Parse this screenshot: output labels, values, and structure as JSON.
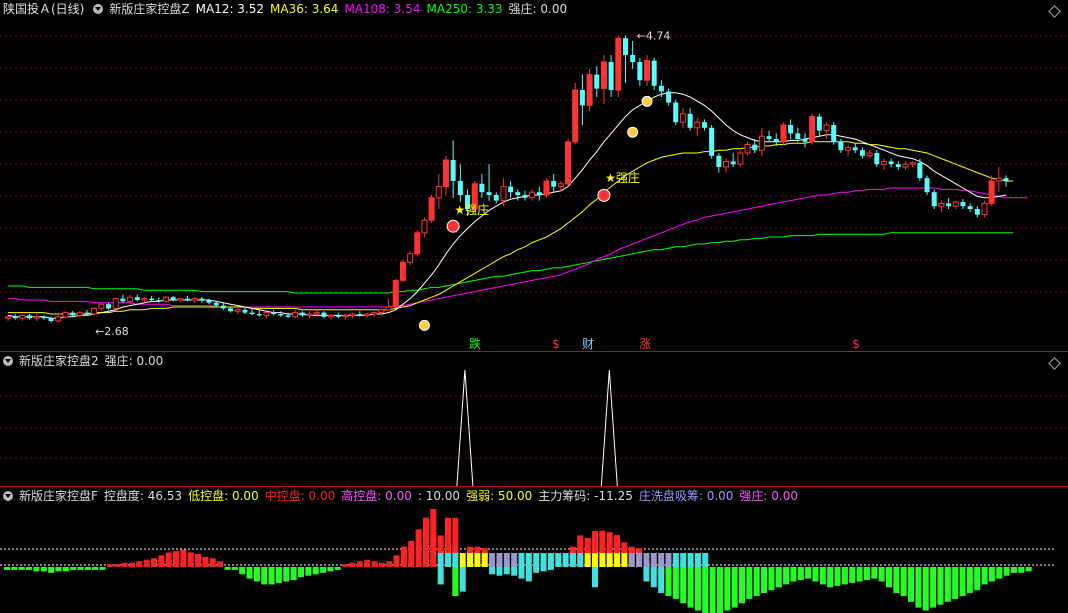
{
  "main": {
    "title": "陕国投Ａ(日线)",
    "indicator": "新版庄家控盘Z",
    "ma12": "MA12: 3.52",
    "ma36": "MA36: 3.64",
    "ma108": "MA108: 3.54",
    "ma250": "MA250: 3.33",
    "qz": "强庄: 0.00",
    "high_label": "4.74",
    "low_label": "2.68",
    "qz_tags": [
      "强庄",
      "强庄"
    ],
    "signals": [
      "跌",
      "$",
      "财",
      "涨",
      "$"
    ]
  },
  "panel2": {
    "indicator": "新版庄家控盘2",
    "qz": "强庄: 0.00"
  },
  "panel3": {
    "indicator": "新版庄家控盘F",
    "kongpandu": "控盘度: 46.53",
    "low": "低控盘: 0.00",
    "mid": "中控盘: 0.00",
    "high": "高控盘: 0.00",
    "ten": ": 10.00",
    "strength": "强弱: 50.00",
    "main_chip": "主力筹码: -11.25",
    "wash": "庄洗盘吸筹: 0.00",
    "qz": "强庄: 0.00"
  },
  "colors": {
    "up": "#ff3333",
    "down": "#54ffff",
    "ma12": "#ffffff",
    "ma36": "#ffff00",
    "ma108": "#ff00ff",
    "ma250": "#00ff00",
    "low": "#ffff00",
    "mid": "#ff2222",
    "high": "#ff55ff",
    "strength": "#ffff00",
    "wash": "#9999ff",
    "qz": "#ff55ff"
  },
  "chart_data": {
    "type": "candlestick",
    "ylim": [
      2.6,
      4.85
    ],
    "candles": [
      [
        2.72,
        2.74,
        2.7,
        2.73
      ],
      [
        2.73,
        2.75,
        2.71,
        2.72
      ],
      [
        2.72,
        2.74,
        2.7,
        2.74
      ],
      [
        2.74,
        2.75,
        2.71,
        2.72
      ],
      [
        2.72,
        2.75,
        2.7,
        2.73
      ],
      [
        2.73,
        2.74,
        2.71,
        2.72
      ],
      [
        2.72,
        2.73,
        2.69,
        2.7
      ],
      [
        2.7,
        2.74,
        2.69,
        2.73
      ],
      [
        2.73,
        2.77,
        2.72,
        2.76
      ],
      [
        2.76,
        2.77,
        2.73,
        2.74
      ],
      [
        2.74,
        2.77,
        2.73,
        2.76
      ],
      [
        2.76,
        2.78,
        2.74,
        2.75
      ],
      [
        2.75,
        2.8,
        2.74,
        2.79
      ],
      [
        2.79,
        2.83,
        2.77,
        2.82
      ],
      [
        2.82,
        2.83,
        2.78,
        2.79
      ],
      [
        2.79,
        2.87,
        2.78,
        2.86
      ],
      [
        2.86,
        2.89,
        2.83,
        2.84
      ],
      [
        2.84,
        2.89,
        2.82,
        2.87
      ],
      [
        2.87,
        2.89,
        2.84,
        2.85
      ],
      [
        2.85,
        2.87,
        2.83,
        2.86
      ],
      [
        2.86,
        2.88,
        2.84,
        2.85
      ],
      [
        2.85,
        2.87,
        2.83,
        2.84
      ],
      [
        2.84,
        2.88,
        2.83,
        2.87
      ],
      [
        2.87,
        2.88,
        2.84,
        2.85
      ],
      [
        2.85,
        2.86,
        2.83,
        2.86
      ],
      [
        2.86,
        2.88,
        2.84,
        2.85
      ],
      [
        2.85,
        2.87,
        2.83,
        2.86
      ],
      [
        2.86,
        2.87,
        2.83,
        2.85
      ],
      [
        2.85,
        2.86,
        2.82,
        2.83
      ],
      [
        2.83,
        2.84,
        2.8,
        2.81
      ],
      [
        2.81,
        2.83,
        2.78,
        2.79
      ],
      [
        2.79,
        2.8,
        2.76,
        2.77
      ],
      [
        2.77,
        2.79,
        2.75,
        2.78
      ],
      [
        2.78,
        2.8,
        2.75,
        2.76
      ],
      [
        2.76,
        2.79,
        2.74,
        2.75
      ],
      [
        2.75,
        2.78,
        2.73,
        2.74
      ],
      [
        2.74,
        2.76,
        2.72,
        2.76
      ],
      [
        2.76,
        2.78,
        2.74,
        2.75
      ],
      [
        2.75,
        2.77,
        2.73,
        2.74
      ],
      [
        2.74,
        2.76,
        2.72,
        2.73
      ],
      [
        2.73,
        2.78,
        2.72,
        2.76
      ],
      [
        2.76,
        2.77,
        2.73,
        2.74
      ],
      [
        2.74,
        2.77,
        2.72,
        2.75
      ],
      [
        2.75,
        2.78,
        2.73,
        2.76
      ],
      [
        2.76,
        2.77,
        2.72,
        2.73
      ],
      [
        2.73,
        2.75,
        2.71,
        2.74
      ],
      [
        2.74,
        2.76,
        2.72,
        2.73
      ],
      [
        2.73,
        2.75,
        2.71,
        2.74
      ],
      [
        2.74,
        2.76,
        2.72,
        2.75
      ],
      [
        2.75,
        2.77,
        2.73,
        2.74
      ],
      [
        2.74,
        2.76,
        2.72,
        2.75
      ],
      [
        2.75,
        2.77,
        2.73,
        2.76
      ],
      [
        2.76,
        2.79,
        2.74,
        2.78
      ],
      [
        2.78,
        2.86,
        2.77,
        2.8
      ],
      [
        2.8,
        3.0,
        2.8,
        2.99
      ],
      [
        2.99,
        3.14,
        2.98,
        3.12
      ],
      [
        3.12,
        3.2,
        3.1,
        3.18
      ],
      [
        3.18,
        3.35,
        3.16,
        3.33
      ],
      [
        3.33,
        3.44,
        3.3,
        3.42
      ],
      [
        3.42,
        3.6,
        3.4,
        3.58
      ],
      [
        3.58,
        3.75,
        3.5,
        3.66
      ],
      [
        3.66,
        3.88,
        3.6,
        3.85
      ],
      [
        3.85,
        3.99,
        3.58,
        3.7
      ],
      [
        3.7,
        3.82,
        3.55,
        3.6
      ],
      [
        3.6,
        3.64,
        3.45,
        3.5
      ],
      [
        3.5,
        3.7,
        3.48,
        3.68
      ],
      [
        3.68,
        3.75,
        3.58,
        3.62
      ],
      [
        3.62,
        3.82,
        3.56,
        3.6
      ],
      [
        3.6,
        3.62,
        3.54,
        3.56
      ],
      [
        3.56,
        3.72,
        3.52,
        3.66
      ],
      [
        3.66,
        3.7,
        3.58,
        3.62
      ],
      [
        3.62,
        3.64,
        3.56,
        3.6
      ],
      [
        3.6,
        3.63,
        3.56,
        3.58
      ],
      [
        3.58,
        3.64,
        3.56,
        3.62
      ],
      [
        3.62,
        3.66,
        3.56,
        3.6
      ],
      [
        3.6,
        3.72,
        3.58,
        3.7
      ],
      [
        3.7,
        3.75,
        3.62,
        3.66
      ],
      [
        3.66,
        3.7,
        3.62,
        3.68
      ],
      [
        3.68,
        4.0,
        3.66,
        3.98
      ],
      [
        3.98,
        4.4,
        3.96,
        4.35
      ],
      [
        4.35,
        4.46,
        4.1,
        4.24
      ],
      [
        4.24,
        4.5,
        4.2,
        4.46
      ],
      [
        4.46,
        4.52,
        4.3,
        4.36
      ],
      [
        4.36,
        4.6,
        4.25,
        4.55
      ],
      [
        4.55,
        4.6,
        4.3,
        4.35
      ],
      [
        4.35,
        4.74,
        4.3,
        4.72
      ],
      [
        4.72,
        4.74,
        4.4,
        4.6
      ],
      [
        4.6,
        4.7,
        4.5,
        4.55
      ],
      [
        4.55,
        4.58,
        4.38,
        4.42
      ],
      [
        4.42,
        4.6,
        4.38,
        4.56
      ],
      [
        4.56,
        4.58,
        4.35,
        4.38
      ],
      [
        4.38,
        4.42,
        4.3,
        4.34
      ],
      [
        4.34,
        4.36,
        4.24,
        4.26
      ],
      [
        4.26,
        4.28,
        4.1,
        4.12
      ],
      [
        4.12,
        4.22,
        4.08,
        4.18
      ],
      [
        4.18,
        4.22,
        4.06,
        4.08
      ],
      [
        4.08,
        4.15,
        4.02,
        4.12
      ],
      [
        4.12,
        4.14,
        4.06,
        4.08
      ],
      [
        4.08,
        4.1,
        3.86,
        3.88
      ],
      [
        3.88,
        3.9,
        3.76,
        3.8
      ],
      [
        3.8,
        3.86,
        3.76,
        3.84
      ],
      [
        3.84,
        3.9,
        3.8,
        3.82
      ],
      [
        3.82,
        3.92,
        3.8,
        3.9
      ],
      [
        3.9,
        3.98,
        3.88,
        3.96
      ],
      [
        3.96,
        4.0,
        3.9,
        3.92
      ],
      [
        3.92,
        4.08,
        3.88,
        4.02
      ],
      [
        4.02,
        4.06,
        3.98,
        4.0
      ],
      [
        4.0,
        4.04,
        3.95,
        3.98
      ],
      [
        3.98,
        4.12,
        3.96,
        4.1
      ],
      [
        4.1,
        4.14,
        4.0,
        4.04
      ],
      [
        4.04,
        4.08,
        3.98,
        4.0
      ],
      [
        4.0,
        4.04,
        3.94,
        3.98
      ],
      [
        3.98,
        4.18,
        3.96,
        4.16
      ],
      [
        4.16,
        4.18,
        4.02,
        4.06
      ],
      [
        4.06,
        4.12,
        4.0,
        4.1
      ],
      [
        4.1,
        4.12,
        3.96,
        3.98
      ],
      [
        3.98,
        4.0,
        3.9,
        3.92
      ],
      [
        3.92,
        3.96,
        3.88,
        3.94
      ],
      [
        3.94,
        3.97,
        3.9,
        3.92
      ],
      [
        3.92,
        3.94,
        3.86,
        3.88
      ],
      [
        3.88,
        3.92,
        3.86,
        3.9
      ],
      [
        3.9,
        3.92,
        3.8,
        3.82
      ],
      [
        3.82,
        3.86,
        3.78,
        3.84
      ],
      [
        3.84,
        3.86,
        3.8,
        3.82
      ],
      [
        3.82,
        3.84,
        3.78,
        3.8
      ],
      [
        3.8,
        3.84,
        3.78,
        3.82
      ],
      [
        3.82,
        3.84,
        3.8,
        3.83
      ],
      [
        3.83,
        3.86,
        3.7,
        3.72
      ],
      [
        3.72,
        3.74,
        3.6,
        3.62
      ],
      [
        3.62,
        3.64,
        3.5,
        3.52
      ],
      [
        3.52,
        3.56,
        3.48,
        3.54
      ],
      [
        3.54,
        3.58,
        3.5,
        3.52
      ],
      [
        3.52,
        3.56,
        3.5,
        3.55
      ],
      [
        3.55,
        3.57,
        3.5,
        3.52
      ],
      [
        3.52,
        3.54,
        3.48,
        3.5
      ],
      [
        3.5,
        3.52,
        3.44,
        3.46
      ],
      [
        3.46,
        3.56,
        3.44,
        3.54
      ],
      [
        3.54,
        3.74,
        3.52,
        3.7
      ],
      [
        3.7,
        3.8,
        3.62,
        3.72
      ],
      [
        3.72,
        3.74,
        3.66,
        3.7
      ]
    ],
    "ma12": [
      2.74,
      2.73,
      2.73,
      2.73,
      2.73,
      2.73,
      2.72,
      2.72,
      2.73,
      2.73,
      2.74,
      2.74,
      2.75,
      2.76,
      2.77,
      2.78,
      2.8,
      2.81,
      2.82,
      2.83,
      2.84,
      2.84,
      2.85,
      2.85,
      2.85,
      2.85,
      2.85,
      2.85,
      2.85,
      2.84,
      2.83,
      2.82,
      2.81,
      2.8,
      2.79,
      2.78,
      2.77,
      2.76,
      2.76,
      2.75,
      2.75,
      2.75,
      2.74,
      2.74,
      2.74,
      2.74,
      2.74,
      2.74,
      2.74,
      2.74,
      2.74,
      2.75,
      2.75,
      2.76,
      2.78,
      2.82,
      2.86,
      2.91,
      2.97,
      3.03,
      3.1,
      3.18,
      3.25,
      3.31,
      3.36,
      3.41,
      3.45,
      3.49,
      3.52,
      3.55,
      3.57,
      3.58,
      3.59,
      3.6,
      3.6,
      3.61,
      3.62,
      3.63,
      3.66,
      3.72,
      3.78,
      3.85,
      3.91,
      3.98,
      4.04,
      4.1,
      4.16,
      4.21,
      4.24,
      4.27,
      4.3,
      4.32,
      4.33,
      4.33,
      4.32,
      4.3,
      4.27,
      4.24,
      4.2,
      4.15,
      4.1,
      4.06,
      4.03,
      4.01,
      3.99,
      3.98,
      3.98,
      3.98,
      3.98,
      3.99,
      3.99,
      4.0,
      4.01,
      4.02,
      4.03,
      4.03,
      4.02,
      4.01,
      4.0,
      3.98,
      3.96,
      3.94,
      3.92,
      3.9,
      3.88,
      3.87,
      3.86,
      3.84,
      3.81,
      3.77,
      3.74,
      3.71,
      3.68,
      3.65,
      3.62,
      3.59,
      3.58,
      3.58,
      3.59,
      3.6
    ],
    "ma36": [
      2.76,
      2.76,
      2.76,
      2.76,
      2.76,
      2.76,
      2.75,
      2.75,
      2.75,
      2.75,
      2.75,
      2.75,
      2.76,
      2.76,
      2.76,
      2.77,
      2.77,
      2.78,
      2.78,
      2.78,
      2.79,
      2.79,
      2.79,
      2.8,
      2.8,
      2.8,
      2.8,
      2.8,
      2.8,
      2.8,
      2.8,
      2.8,
      2.8,
      2.8,
      2.79,
      2.79,
      2.79,
      2.79,
      2.79,
      2.79,
      2.79,
      2.78,
      2.78,
      2.78,
      2.78,
      2.78,
      2.78,
      2.78,
      2.78,
      2.78,
      2.78,
      2.78,
      2.78,
      2.78,
      2.79,
      2.8,
      2.81,
      2.83,
      2.85,
      2.87,
      2.89,
      2.92,
      2.95,
      2.98,
      3.01,
      3.04,
      3.07,
      3.1,
      3.13,
      3.16,
      3.18,
      3.21,
      3.23,
      3.26,
      3.28,
      3.3,
      3.33,
      3.36,
      3.4,
      3.44,
      3.48,
      3.53,
      3.57,
      3.62,
      3.66,
      3.7,
      3.74,
      3.77,
      3.8,
      3.83,
      3.85,
      3.87,
      3.88,
      3.89,
      3.9,
      3.9,
      3.9,
      3.91,
      3.91,
      3.92,
      3.92,
      3.93,
      3.93,
      3.94,
      3.94,
      3.95,
      3.95,
      3.96,
      3.96,
      3.97,
      3.97,
      3.97,
      3.98,
      3.98,
      3.98,
      3.98,
      3.98,
      3.98,
      3.97,
      3.97,
      3.96,
      3.96,
      3.95,
      3.94,
      3.93,
      3.93,
      3.92,
      3.91,
      3.9,
      3.88,
      3.86,
      3.84,
      3.82,
      3.8,
      3.78,
      3.76,
      3.74,
      3.72,
      3.71,
      3.7,
      3.7
    ],
    "ma108": [
      2.86,
      2.86,
      2.85,
      2.85,
      2.85,
      2.85,
      2.84,
      2.84,
      2.84,
      2.84,
      2.84,
      2.84,
      2.83,
      2.83,
      2.83,
      2.83,
      2.83,
      2.83,
      2.82,
      2.82,
      2.82,
      2.82,
      2.82,
      2.81,
      2.81,
      2.81,
      2.81,
      2.81,
      2.81,
      2.8,
      2.8,
      2.8,
      2.8,
      2.8,
      2.8,
      2.8,
      2.8,
      2.8,
      2.8,
      2.8,
      2.8,
      2.8,
      2.8,
      2.8,
      2.8,
      2.8,
      2.8,
      2.8,
      2.8,
      2.8,
      2.8,
      2.8,
      2.8,
      2.8,
      2.81,
      2.81,
      2.82,
      2.83,
      2.84,
      2.85,
      2.86,
      2.87,
      2.88,
      2.89,
      2.9,
      2.91,
      2.92,
      2.93,
      2.94,
      2.95,
      2.96,
      2.97,
      2.98,
      2.99,
      3.0,
      3.01,
      3.02,
      3.03,
      3.05,
      3.07,
      3.09,
      3.11,
      3.14,
      3.16,
      3.18,
      3.21,
      3.23,
      3.25,
      3.27,
      3.29,
      3.31,
      3.33,
      3.35,
      3.37,
      3.39,
      3.41,
      3.42,
      3.44,
      3.45,
      3.46,
      3.47,
      3.48,
      3.49,
      3.5,
      3.51,
      3.52,
      3.53,
      3.54,
      3.55,
      3.56,
      3.57,
      3.58,
      3.59,
      3.6,
      3.6,
      3.61,
      3.62,
      3.62,
      3.63,
      3.63,
      3.64,
      3.64,
      3.64,
      3.65,
      3.65,
      3.65,
      3.65,
      3.65,
      3.65,
      3.65,
      3.64,
      3.64,
      3.64,
      3.63,
      3.63,
      3.62,
      3.61,
      3.6,
      3.59,
      3.58,
      3.58,
      3.58,
      3.58
    ],
    "ma250": [
      2.95,
      2.95,
      2.95,
      2.94,
      2.94,
      2.94,
      2.94,
      2.94,
      2.94,
      2.94,
      2.94,
      2.94,
      2.93,
      2.93,
      2.93,
      2.93,
      2.93,
      2.93,
      2.93,
      2.92,
      2.92,
      2.92,
      2.92,
      2.92,
      2.92,
      2.92,
      2.92,
      2.91,
      2.91,
      2.91,
      2.91,
      2.91,
      2.91,
      2.91,
      2.91,
      2.91,
      2.91,
      2.91,
      2.91,
      2.91,
      2.9,
      2.9,
      2.9,
      2.9,
      2.9,
      2.9,
      2.9,
      2.9,
      2.9,
      2.9,
      2.9,
      2.9,
      2.9,
      2.9,
      2.91,
      2.91,
      2.92,
      2.92,
      2.93,
      2.94,
      2.94,
      2.95,
      2.96,
      2.97,
      2.98,
      2.99,
      3.0,
      3.01,
      3.02,
      3.02,
      3.03,
      3.04,
      3.05,
      3.06,
      3.06,
      3.07,
      3.08,
      3.08,
      3.09,
      3.1,
      3.11,
      3.12,
      3.13,
      3.14,
      3.15,
      3.16,
      3.17,
      3.18,
      3.19,
      3.2,
      3.21,
      3.21,
      3.22,
      3.23,
      3.23,
      3.24,
      3.25,
      3.25,
      3.26,
      3.26,
      3.27,
      3.27,
      3.28,
      3.28,
      3.29,
      3.29,
      3.3,
      3.3,
      3.3,
      3.31,
      3.31,
      3.31,
      3.31,
      3.32,
      3.32,
      3.32,
      3.32,
      3.32,
      3.32,
      3.32,
      3.32,
      3.32,
      3.32,
      3.33,
      3.33,
      3.33,
      3.33,
      3.33,
      3.33,
      3.33,
      3.33,
      3.33,
      3.33,
      3.33,
      3.33,
      3.33,
      3.33,
      3.33,
      3.33,
      3.33,
      3.33
    ],
    "spikes": [
      {
        "bar": 55,
        "value": 1
      },
      {
        "bar": 74,
        "value": 1
      }
    ],
    "bars": [
      -2,
      -2,
      -2,
      -2,
      -3,
      -3,
      -4,
      -3,
      -3,
      -2,
      -2,
      -2,
      -2,
      -2,
      2,
      2,
      3,
      3,
      4,
      5,
      6,
      8,
      10,
      11,
      12,
      10,
      9,
      7,
      6,
      4,
      -2,
      -2,
      -5,
      -8,
      -10,
      -12,
      -12,
      -11,
      -10,
      -9,
      -7,
      -6,
      -5,
      -4,
      -3,
      -2,
      2,
      3,
      4,
      5,
      4,
      3,
      4,
      8,
      14,
      18,
      26,
      34,
      40,
      -12,
      12,
      -20,
      -17,
      14,
      14,
      13,
      -5,
      -6,
      -5,
      -6,
      -8,
      -10,
      -4,
      -3,
      -2,
      2,
      3,
      14,
      17,
      20,
      -14,
      25,
      24,
      22,
      17,
      14,
      13,
      -10,
      -14,
      -18,
      -20,
      -22,
      -25,
      -28,
      -30,
      -35,
      -40,
      -36,
      -30,
      -28,
      -25,
      -22,
      -20,
      -18,
      -16,
      -14,
      -12,
      -10,
      -9,
      -8,
      -10,
      -12,
      -14,
      -13,
      -12,
      -11,
      -10,
      -9,
      -8,
      -10,
      -14,
      -18,
      -20,
      -24,
      -28,
      -30,
      -28,
      -26,
      -24,
      -22,
      -20,
      -18,
      -16,
      -12,
      -10,
      -8,
      -6,
      -4,
      -4,
      -3
    ],
    "bar_types": "lime",
    "red_extra": [
      [
        53,
        6
      ],
      [
        54,
        8
      ],
      [
        55,
        8
      ],
      [
        56,
        16
      ],
      [
        57,
        16
      ],
      [
        74,
        8
      ],
      [
        75,
        6
      ],
      [
        76,
        10
      ]
    ]
  }
}
